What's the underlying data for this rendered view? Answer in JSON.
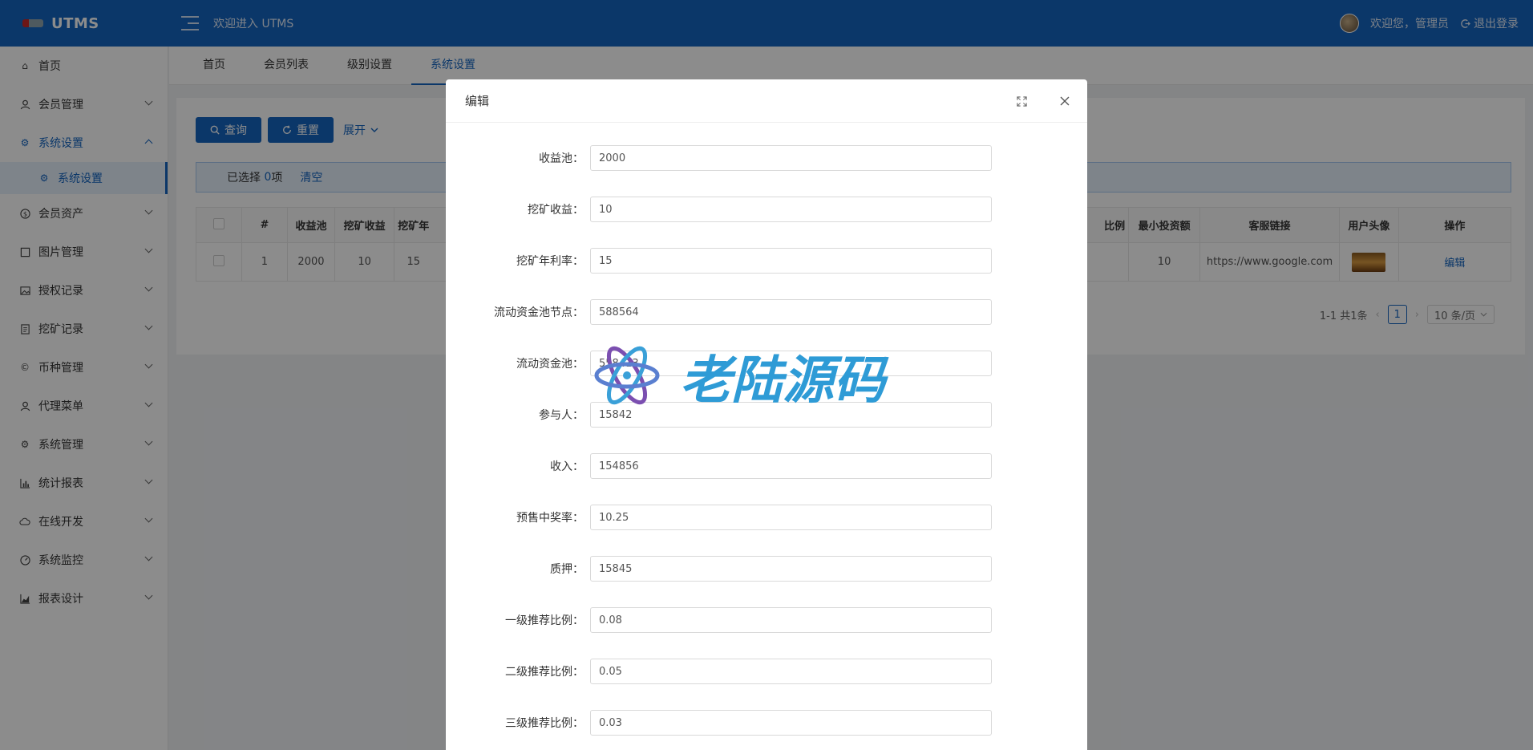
{
  "header": {
    "logo": "UTMS",
    "welcome": "欢迎进入 UTMS",
    "user_greeting": "欢迎您，管理员",
    "logout": "退出登录"
  },
  "sidebar": {
    "items": [
      {
        "label": "首页",
        "icon": "home-icon"
      },
      {
        "label": "会员管理",
        "icon": "user-icon"
      },
      {
        "label": "系统设置",
        "icon": "gear-icon"
      },
      {
        "label": "会员资产",
        "icon": "dollar-icon"
      },
      {
        "label": "图片管理",
        "icon": "square-icon"
      },
      {
        "label": "授权记录",
        "icon": "image-icon"
      },
      {
        "label": "挖矿记录",
        "icon": "document-icon"
      },
      {
        "label": "币种管理",
        "icon": "copyright-icon"
      },
      {
        "label": "代理菜单",
        "icon": "user-icon"
      },
      {
        "label": "系统管理",
        "icon": "gear-icon"
      },
      {
        "label": "统计报表",
        "icon": "bar-chart-icon"
      },
      {
        "label": "在线开发",
        "icon": "cloud-icon"
      },
      {
        "label": "系统监控",
        "icon": "dashboard-icon"
      },
      {
        "label": "报表设计",
        "icon": "area-chart-icon"
      }
    ],
    "sub_item": "系统设置"
  },
  "tabs": [
    "首页",
    "会员列表",
    "级别设置",
    "系统设置"
  ],
  "toolbar": {
    "query": "查询",
    "reset": "重置",
    "expand": "展开"
  },
  "selection": {
    "prefix": "已选择",
    "count": "0",
    "suffix": "项",
    "clear": "清空"
  },
  "table": {
    "headers": [
      "#",
      "收益池",
      "挖矿收益",
      "挖矿年",
      "比例",
      "最小投资额",
      "客服链接",
      "用户头像",
      "操作"
    ],
    "row": [
      "1",
      "2000",
      "10",
      "15",
      "",
      "10",
      "https://www.google.com",
      "",
      "编辑"
    ]
  },
  "pager": {
    "summary": "1-1 共1条",
    "page": "1",
    "size": "10 条/页"
  },
  "modal": {
    "title": "编辑",
    "fields": [
      {
        "label": "收益池：",
        "value": "2000"
      },
      {
        "label": "挖矿收益：",
        "value": "10"
      },
      {
        "label": "挖矿年利率：",
        "value": "15"
      },
      {
        "label": "流动资金池节点：",
        "value": "588564"
      },
      {
        "label": "流动资金池：",
        "value": "558413"
      },
      {
        "label": "参与人：",
        "value": "15842"
      },
      {
        "label": "收入：",
        "value": "154856"
      },
      {
        "label": "预售中奖率：",
        "value": "10.25"
      },
      {
        "label": "质押：",
        "value": "15845"
      },
      {
        "label": "一级推荐比例：",
        "value": "0.08"
      },
      {
        "label": "二级推荐比例：",
        "value": "0.05"
      },
      {
        "label": "三级推荐比例：",
        "value": "0.03"
      }
    ]
  },
  "watermark": "老陆源码"
}
